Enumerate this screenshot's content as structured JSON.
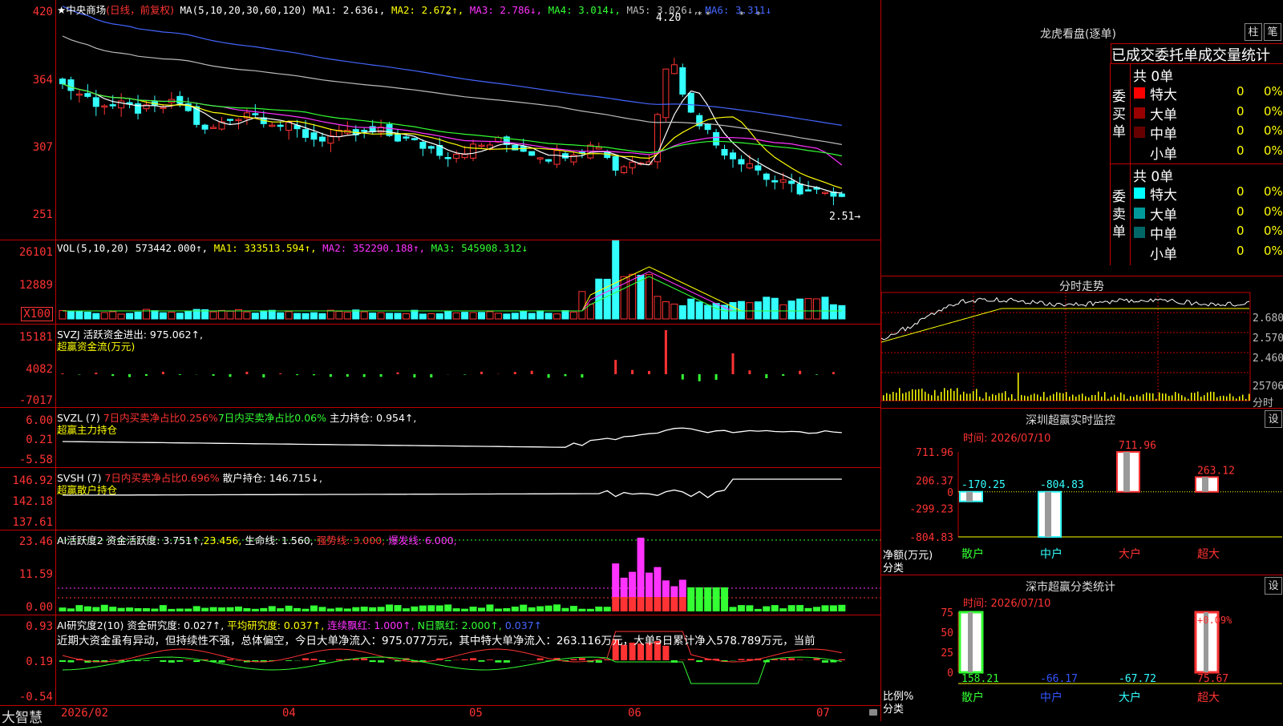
{
  "stock": {
    "title": "★中央商场",
    "mode": "(日线，前复权)",
    "ma_hdr": "MA(5,10,20,30,60,120)",
    "ma1": "MA1: 2.636↓,",
    "ma2": "MA2: 2.672↑,",
    "ma3": "MA3: 2.786↓,",
    "ma4": "MA4: 3.014↓,",
    "ma5": "MA5: 3.026↓,",
    "ma6": "MA6: 3.311↓",
    "price_high_mark": "4.20",
    "price_low_mark": "2.51→",
    "y_ticks": [
      "420",
      "364",
      "307",
      "251"
    ]
  },
  "vol": {
    "hdr": "VOL(5,10,20)",
    "value": "573442.000↑,",
    "ma1": "MA1: 333513.594↑,",
    "ma2": "MA2: 352290.188↑,",
    "ma3": "MA3: 545908.312↓",
    "y_ticks": [
      "26101",
      "12889"
    ],
    "unit": "X100"
  },
  "svzj": {
    "hdr": "SVZJ  活跃资金进出: 975.062↑,",
    "sub": "超赢资金流(万元)",
    "y_ticks": [
      "15181",
      "4082",
      "-7017"
    ]
  },
  "svzl": {
    "hdr_a": "SVZL (7)",
    "hdr_b": "7日内买卖净占比0.256%",
    "hdr_c": "7日内买卖净占比0.06%",
    "hdr_d": "主力持仓: 0.954↑,",
    "sub": "超赢主力持仓",
    "y_ticks": [
      "6.00",
      "0.21",
      "-5.58"
    ]
  },
  "svsh": {
    "hdr_a": "SVSH (7)",
    "hdr_b": "7日内买卖净占比0.696%",
    "hdr_c": "散户持仓: 146.715↓,",
    "sub": "超赢散户持仓",
    "y_ticks": [
      "146.92",
      "142.18",
      "137.61"
    ]
  },
  "ai1": {
    "hdr_a": "AI活跃度2",
    "hdr_b": "资金活跃度: 3.751↑,",
    "hdr_c": "23.456,",
    "hdr_d": "生命线: 1.560,",
    "hdr_e": "强势线: 3.000,",
    "hdr_f": "爆发线: 6.000,",
    "y_ticks": [
      "23.46",
      "11.59",
      "0.00"
    ]
  },
  "ai2": {
    "hdr_a": "AI研究度2(10)",
    "hdr_b": "资金研究度: 0.027↑,",
    "hdr_c": "平均研究度: 0.037↑,",
    "hdr_d": "连续飘红: 1.000↑,",
    "hdr_e": "N日飘红: 2.000↑,",
    "hdr_f": "0.037↑",
    "comment": "近期大资金虽有异动，但持续性不强，总体偏空，今日大单净流入：975.077万元，其中特大单净流入：263.116万元，大单5日累计净入578.789万元，当前",
    "y_ticks": [
      "0.93",
      "0.19",
      "-0.54"
    ]
  },
  "xaxis": {
    "brand": "大智慧",
    "labels": [
      "2026/02",
      "04",
      "05",
      "06",
      "07"
    ]
  },
  "lhb": {
    "title": "龙虎看盘(逐单)",
    "btn_a": "柱",
    "btn_b": "笔",
    "tabs": "已成交委托单成交量统计",
    "buy_label": "委买单",
    "sell_label": "委卖单",
    "buy_total": "共 0单",
    "sell_total": "共 0单",
    "buy_rows": [
      {
        "name": "特大",
        "count": "0",
        "pct": "0%",
        "color": "#ff0000"
      },
      {
        "name": "大单",
        "count": "0",
        "pct": "0%",
        "color": "#990000"
      },
      {
        "name": "中单",
        "count": "0",
        "pct": "0%",
        "color": "#660000"
      },
      {
        "name": "小单",
        "count": "0",
        "pct": "0%",
        "color": "#000000"
      }
    ],
    "sell_rows": [
      {
        "name": "特大",
        "count": "0",
        "pct": "0%",
        "color": "#00ffff"
      },
      {
        "name": "大单",
        "count": "0",
        "pct": "0%",
        "color": "#009999"
      },
      {
        "name": "中单",
        "count": "0",
        "pct": "0%",
        "color": "#006666"
      },
      {
        "name": "小单",
        "count": "0",
        "pct": "0%",
        "color": "#000000"
      }
    ]
  },
  "intraday": {
    "title": "分时走势",
    "y_ticks": [
      "2.680",
      "2.570",
      "2.460"
    ],
    "vol_tick": "25706",
    "unit": "分时"
  },
  "sz_monitor": {
    "title": "深圳超赢实时监控",
    "btn": "设",
    "time": "时间: 2026/07/10",
    "y_ticks": [
      "711.96",
      "206.37",
      "0",
      "-299.23",
      "-804.83"
    ],
    "ylabel": "净额(万元)",
    "xlabel": "分类",
    "categories": [
      "散户",
      "中户",
      "大户",
      "超大"
    ],
    "values": [
      "-170.25",
      "-804.83",
      "711.96",
      "263.12"
    ]
  },
  "sz_class": {
    "title": "深市超赢分类统计",
    "btn": "设",
    "time": "时间: 2026/07/10",
    "y_ticks": [
      "75",
      "50",
      "25",
      "0"
    ],
    "ylabel": "比例%",
    "xlabel": "分类",
    "pct_label": "+0.09%",
    "categories": [
      "散户",
      "中户",
      "大户",
      "超大"
    ],
    "values": [
      "158.21",
      "-66.17",
      "-67.72",
      "75.67"
    ]
  },
  "chart_data": [
    {
      "type": "bar",
      "title": "深圳超赢实时监控",
      "ylabel": "净额(万元)",
      "xlabel": "分类",
      "categories": [
        "散户",
        "中户",
        "大户",
        "超大"
      ],
      "values": [
        -170.25,
        -804.83,
        711.96,
        263.12
      ],
      "ylim": [
        -804.83,
        711.96
      ]
    },
    {
      "type": "bar",
      "title": "深市超赢分类统计",
      "ylabel": "比例%",
      "xlabel": "分类",
      "categories": [
        "散户",
        "中户",
        "大户",
        "超大"
      ],
      "values": [
        158.21,
        -66.17,
        -67.72,
        75.67
      ],
      "ylim": [
        0,
        75
      ]
    }
  ]
}
